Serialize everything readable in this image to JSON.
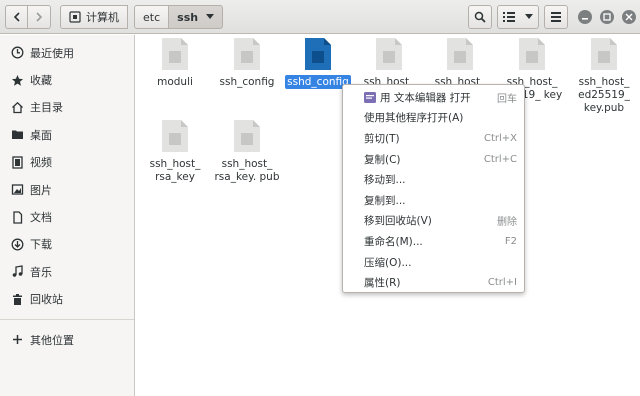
{
  "header": {
    "path": [
      "计算机",
      "etc",
      "ssh"
    ],
    "icons": [
      "back-icon",
      "forward-icon",
      "root-icon",
      "dropdown-icon",
      "search-icon",
      "view-list-icon",
      "menu-icon",
      "minimize-icon",
      "maximize-icon",
      "close-icon"
    ]
  },
  "sidebar": {
    "items": [
      {
        "label": "最近使用",
        "icon": "recent-icon"
      },
      {
        "label": "收藏",
        "icon": "star-icon"
      },
      {
        "label": "主目录",
        "icon": "home-icon"
      },
      {
        "label": "桌面",
        "icon": "desktop-icon"
      },
      {
        "label": "视频",
        "icon": "video-icon"
      },
      {
        "label": "图片",
        "icon": "image-icon"
      },
      {
        "label": "文档",
        "icon": "document-icon"
      },
      {
        "label": "下载",
        "icon": "download-icon"
      },
      {
        "label": "音乐",
        "icon": "music-icon"
      },
      {
        "label": "回收站",
        "icon": "trash-icon"
      },
      {
        "label": "其他位置",
        "icon": "plus-icon"
      }
    ]
  },
  "files": [
    {
      "name": "moduli",
      "selected": false
    },
    {
      "name": "ssh_config",
      "selected": false
    },
    {
      "name": "sshd_config",
      "selected": true
    },
    {
      "name": "ssh_host_",
      "selected": false
    },
    {
      "name": "ssh_host_",
      "selected": false
    },
    {
      "name": "ssh_host_ 25519_ key",
      "selected": false
    },
    {
      "name": "ssh_host_ ed25519_ key.pub",
      "selected": false
    },
    {
      "name": "ssh_host_ rsa_key",
      "selected": false
    },
    {
      "name": "ssh_host_ rsa_key. pub",
      "selected": false
    }
  ],
  "context_menu": {
    "items": [
      {
        "label": "用 文本编辑器 打开",
        "accel": "回车"
      },
      {
        "label": "使用其他程序打开(A)",
        "accel": ""
      },
      {
        "label": "剪切(T)",
        "accel": "Ctrl+X"
      },
      {
        "label": "复制(C)",
        "accel": "Ctrl+C"
      },
      {
        "label": "移动到...",
        "accel": ""
      },
      {
        "label": "复制到...",
        "accel": ""
      },
      {
        "label": "移到回收站(V)",
        "accel": "删除"
      },
      {
        "label": "重命名(M)...",
        "accel": "F2"
      },
      {
        "label": "压缩(O)...",
        "accel": ""
      },
      {
        "label": "属性(R)",
        "accel": "Ctrl+I"
      }
    ]
  },
  "colors": {
    "accent": "#3584e4",
    "selected_file": "#1f6fb8"
  }
}
